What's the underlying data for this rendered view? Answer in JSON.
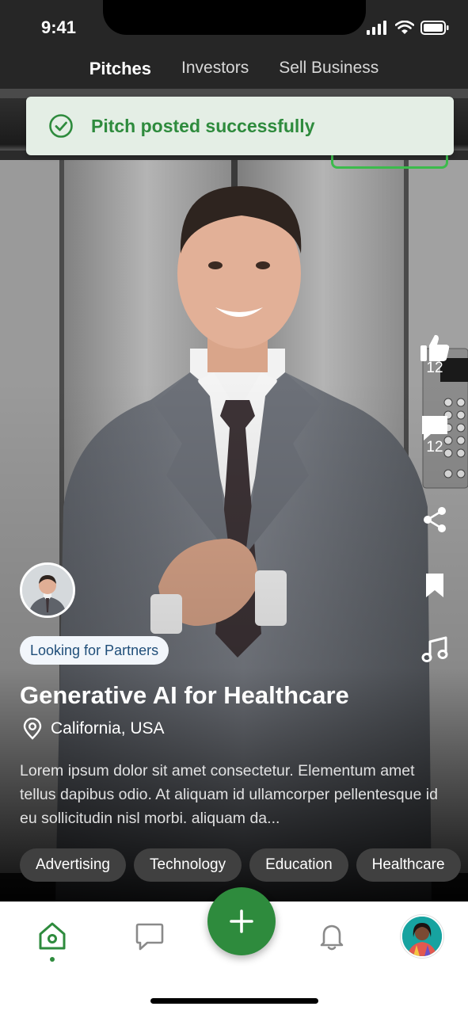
{
  "status_bar": {
    "time": "9:41"
  },
  "top_tabs": [
    {
      "label": "Pitches",
      "active": true
    },
    {
      "label": "Investors",
      "active": false
    },
    {
      "label": "Sell Business",
      "active": false
    }
  ],
  "toast": {
    "message": "Pitch posted successfully",
    "icon": "check-circle-icon",
    "color": "#2e8b3d"
  },
  "rail": {
    "likes": {
      "icon": "thumbs-up-icon",
      "count": "12"
    },
    "comments": {
      "icon": "comment-icon",
      "count": "12"
    },
    "share": {
      "icon": "share-icon"
    },
    "bookmark": {
      "icon": "bookmark-icon"
    },
    "music": {
      "icon": "music-note-icon"
    }
  },
  "pitch": {
    "status_tag": "Looking for Partners",
    "title": "Generative AI for Healthcare",
    "location": "California, USA",
    "description": "Lorem ipsum dolor sit amet consectetur. Elementum amet tellus dapibus odio. At aliquam id ullamcorper pellentesque id eu sollicitudin nisl morbi. aliquam da...",
    "tags": [
      "Advertising",
      "Technology",
      "Education",
      "Healthcare"
    ]
  },
  "bottom_nav": {
    "items": [
      {
        "icon": "home-icon",
        "active": true
      },
      {
        "icon": "chat-icon",
        "active": false
      },
      {
        "icon": "plus-icon",
        "active": false
      },
      {
        "icon": "bell-icon",
        "active": false
      },
      {
        "icon": "profile-avatar",
        "active": false
      }
    ],
    "accent": "#2e8b3d"
  }
}
